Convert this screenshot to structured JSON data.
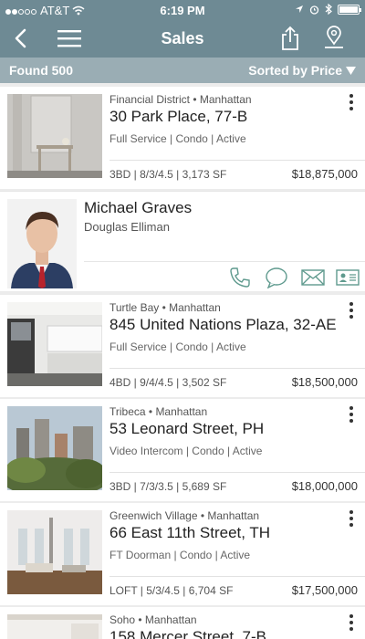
{
  "status_bar": {
    "carrier": "AT&T",
    "time": "6:19 PM"
  },
  "nav": {
    "title": "Sales"
  },
  "results": {
    "found": "Found 500",
    "sort": "Sorted by Price"
  },
  "listings": [
    {
      "neighborhood": "Financial District • Manhattan",
      "address": "30 Park Place, 77-B",
      "features": "Full Service | Condo | Active",
      "specs": "3BD | 8/3/4.5 | 3,173 SF",
      "price": "$18,875,000"
    },
    {
      "neighborhood": "Turtle Bay • Manhattan",
      "address": "845 United Nations Plaza, 32-AE",
      "features": "Full Service | Condo | Active",
      "specs": "4BD | 9/4/4.5 | 3,502 SF",
      "price": "$18,500,000"
    },
    {
      "neighborhood": "Tribeca • Manhattan",
      "address": "53 Leonard Street, PH",
      "features": "Video Intercom | Condo | Active",
      "specs": "3BD | 7/3/3.5 | 5,689 SF",
      "price": "$18,000,000"
    },
    {
      "neighborhood": "Greenwich Village • Manhattan",
      "address": "66 East 11th Street, TH",
      "features": "FT Doorman | Condo | Active",
      "specs": "LOFT | 5/3/4.5 | 6,704 SF",
      "price": "$17,500,000"
    },
    {
      "neighborhood": "Soho • Manhattan",
      "address": "158 Mercer Street, 7-B",
      "features": "",
      "specs": "",
      "price": ""
    }
  ],
  "agent": {
    "name": "Michael Graves",
    "firm": "Douglas Elliman"
  },
  "icons": [
    "back-icon",
    "menu-icon",
    "share-icon",
    "map-pin-icon",
    "phone-icon",
    "chat-icon",
    "mail-icon",
    "contact-card-icon",
    "more-icon",
    "sort-arrow-icon"
  ],
  "colors": {
    "header": "#6e8a94",
    "subheader": "#9aadb4",
    "action_icons": "#5f9a8e"
  }
}
